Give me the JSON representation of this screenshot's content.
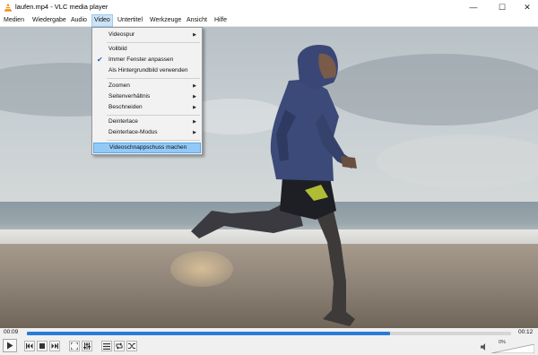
{
  "window": {
    "title": "laufen.mp4 - VLC media player",
    "buttons": {
      "minimize": "—",
      "maximize": "☐",
      "close": "✕"
    }
  },
  "menubar": {
    "items": [
      "Medien",
      "Wiedergabe",
      "Audio",
      "Video",
      "Untertitel",
      "Werkzeuge",
      "Ansicht",
      "Hilfe"
    ],
    "active": "Video"
  },
  "video_menu": {
    "items": [
      {
        "label": "Videospur",
        "submenu": true,
        "checked": false
      },
      {
        "label": "Vollbild",
        "submenu": false,
        "checked": false
      },
      {
        "label": "Immer Fenster anpassen",
        "submenu": false,
        "checked": true
      },
      {
        "label": "Als Hintergrundbild verwenden",
        "submenu": false,
        "checked": false
      },
      {
        "label": "Zoomen",
        "submenu": true,
        "checked": false
      },
      {
        "label": "Seitenverhältnis",
        "submenu": true,
        "checked": false
      },
      {
        "label": "Beschneiden",
        "submenu": true,
        "checked": false
      },
      {
        "label": "Deinterlace",
        "submenu": true,
        "checked": false
      },
      {
        "label": "Deinterlace-Modus",
        "submenu": true,
        "checked": false
      },
      {
        "label": "Videoschnappschuss machen",
        "submenu": false,
        "checked": false,
        "highlighted": true
      }
    ]
  },
  "player": {
    "elapsed": "00:09",
    "duration": "00:12",
    "progress_fraction": 0.75,
    "volume_label": "0%",
    "volume_fraction": 0.0
  },
  "controls": {
    "icons": [
      "play-icon",
      "previous-icon",
      "stop-icon",
      "next-icon",
      "fullscreen-icon",
      "extended-settings-icon",
      "playlist-icon",
      "loop-icon",
      "shuffle-icon",
      "speaker-icon"
    ]
  },
  "colors": {
    "accent": "#2a7bd8",
    "menu_highlight": "#91c9f7",
    "menubar_active": "#cce4f7"
  }
}
